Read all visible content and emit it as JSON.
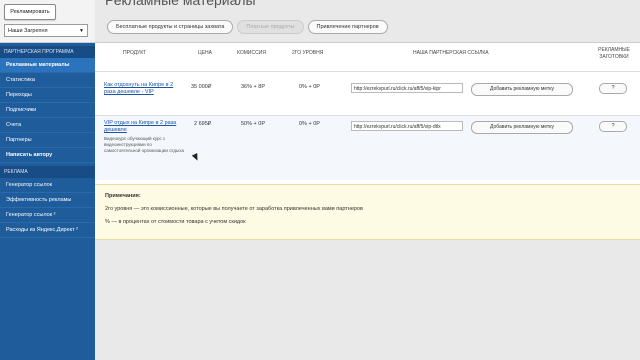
{
  "sidebar": {
    "top_button": "Рекламировать",
    "select_value": "Наши Загрепня",
    "section1": "ПАРТНЕРСКАЯ ПРОГРАММА",
    "items1": [
      "Рекламные материалы",
      "Статистика",
      "Переходы",
      "Подписчики",
      "Счета",
      "Партнеры",
      "Написать автору"
    ],
    "section2": "РЕКЛАМА",
    "items2": [
      "Генератор ссылок",
      "Эффективность рекламы",
      "Генератор ссылок ²",
      "Расходы из Яндекс.Директ ²"
    ]
  },
  "page": {
    "title": "Рекламные материалы",
    "tabs": [
      "Бесплатные продукты и страницы захвата",
      "Платные продукты",
      "Привлечение партнеров"
    ]
  },
  "table": {
    "headers": [
      "ПРОДУКТ",
      "ЦЕНА",
      "КОМИССИЯ",
      "2ГО УРОВНЯ",
      "НАША ПАРТНЕРСКАЯ ССЫЛКА",
      "РЕКЛАМНЫЕ ЗАГОТОВКИ"
    ],
    "rows": [
      {
        "product": "Как отдохнуть на Кипре в 2 раза дешевле - VIP",
        "desc": "",
        "price": "35 000₽",
        "commission": "36% + 8P",
        "level2": "0% + 0P",
        "link": "http://ezrekvpurl.ru/click.ru/aff/5/vip-kipr",
        "button": "Добавить рекламную метку",
        "templates": "?"
      },
      {
        "product": "VIP отдых на Кипре в 2 раза дешевле",
        "desc": "Видеокурс обучающий курс с видеоинструкциями по самостоятельной организации отдыха",
        "price": "2 695₽",
        "commission": "50% + 0P",
        "level2": "0% + 0P",
        "link": "http://ezrekvpurl.ru/click.ru/aff/5/vip-dtlx",
        "button": "Добавить рекламную метку",
        "templates": "?"
      }
    ]
  },
  "notes": {
    "title": "Примечания:",
    "line1": "2го уровня — это комиссионные, которые вы получаете от заработка привлеченных вами партнеров",
    "line2": "% — в процентах от стоимости товара с учетом скидок"
  }
}
